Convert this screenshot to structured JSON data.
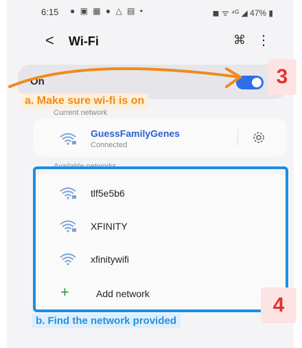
{
  "status_bar": {
    "time": "6:15",
    "left_icons": "● ▣ ▦ ● △ ▤ •",
    "right_text": "◼ ᯤ ⁴ᴳ ◢ 47% ▮"
  },
  "header": {
    "title": "Wi-Fi",
    "back_icon": "<",
    "scan_icon": "⌘",
    "more_icon": "⋮"
  },
  "toggle": {
    "label": "On",
    "state": "on"
  },
  "annotations": {
    "a": "a. Make sure wi-fi is on",
    "b": "b. Find the network provided",
    "callout_3": "3",
    "callout_4": "4"
  },
  "current_network": {
    "section_label": "Current network",
    "name": "GuessFamilyGenes",
    "status": "Connected"
  },
  "available_networks": {
    "section_label": "Available networks",
    "items": [
      {
        "name": "tlf5e5b6",
        "icon": "wifi-locked-icon"
      },
      {
        "name": "XFINITY",
        "icon": "wifi-locked-icon"
      },
      {
        "name": "xfinitywifi",
        "icon": "wifi-open-icon"
      }
    ],
    "add_label": "Add network"
  },
  "colors": {
    "accent_blue": "#2f6ee8",
    "annotation_orange": "#f08a1c",
    "annotation_blue": "#1a8fe0",
    "callout_red": "#e03434"
  }
}
